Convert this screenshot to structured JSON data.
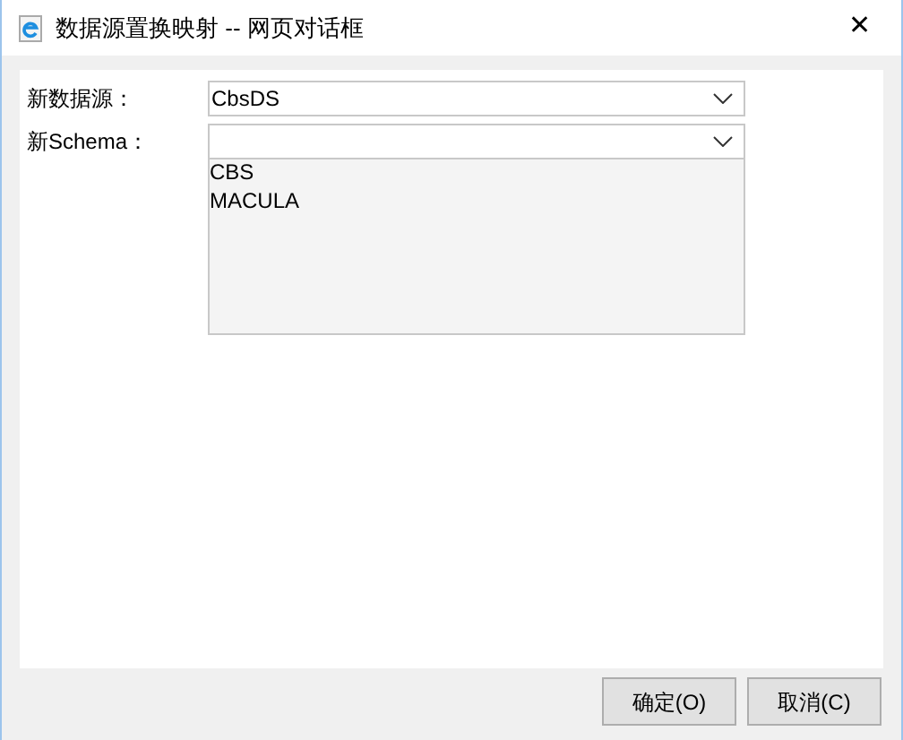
{
  "window": {
    "title": "数据源置换映射 -- 网页对话框",
    "close": "✕"
  },
  "fields": [
    {
      "label": "新数据源：",
      "value": "CbsDS"
    },
    {
      "label": "新Schema："
    }
  ],
  "schema_list": {
    "items": [
      {
        "label": "CBS",
        "selected": false
      },
      {
        "label": "MACULA",
        "selected": false
      }
    ]
  },
  "buttons": [
    "确定(O)",
    "取消(C)"
  ]
}
